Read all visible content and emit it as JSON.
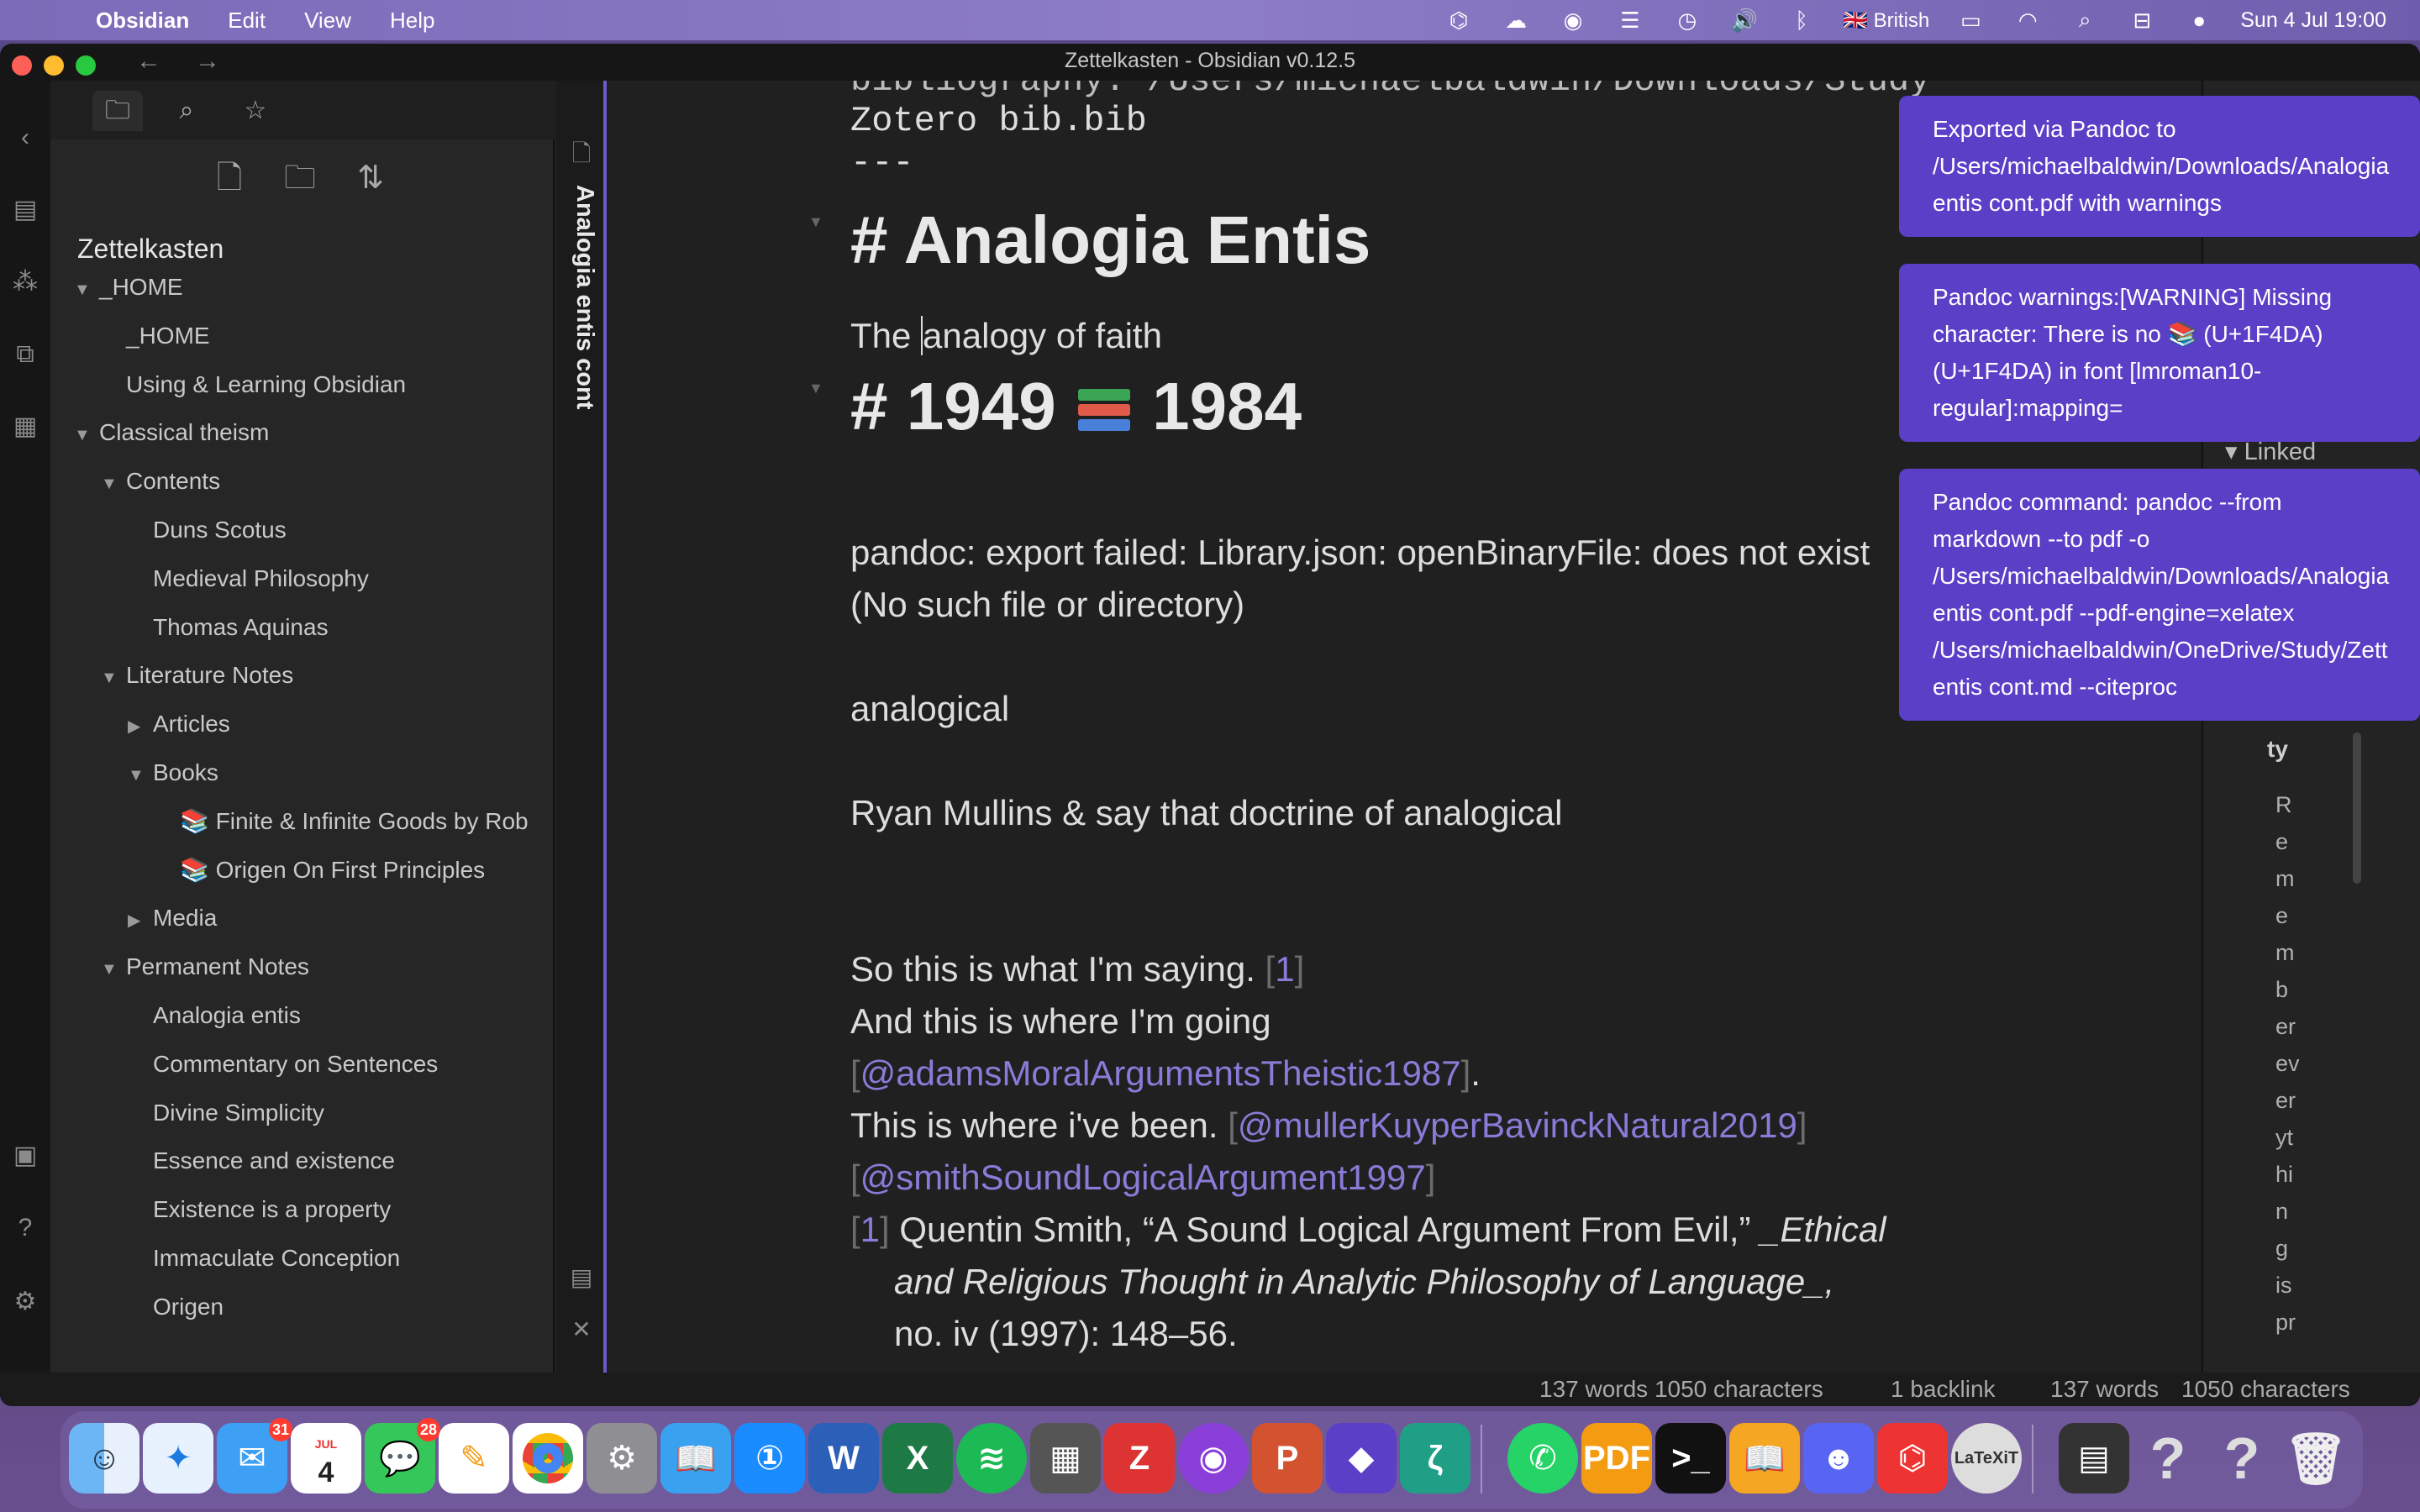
{
  "menubar": {
    "app": "Obsidian",
    "items": [
      "Edit",
      "View",
      "Help"
    ],
    "input_source": "British",
    "clock": "Sun 4 Jul  19:00"
  },
  "window": {
    "title": "Zettelkasten - Obsidian v0.12.5"
  },
  "explorer": {
    "vault": "Zettelkasten",
    "tree": [
      {
        "label": "_HOME",
        "depth": 0,
        "arrow": "▼"
      },
      {
        "label": "_HOME",
        "depth": 1,
        "arrow": ""
      },
      {
        "label": "Using & Learning Obsidian",
        "depth": 1,
        "arrow": ""
      },
      {
        "label": "Classical theism",
        "depth": 0,
        "arrow": "▼"
      },
      {
        "label": "Contents",
        "depth": 1,
        "arrow": "▼"
      },
      {
        "label": "Duns Scotus",
        "depth": 2,
        "arrow": ""
      },
      {
        "label": "Medieval Philosophy",
        "depth": 2,
        "arrow": ""
      },
      {
        "label": "Thomas Aquinas",
        "depth": 2,
        "arrow": ""
      },
      {
        "label": "Literature Notes",
        "depth": 1,
        "arrow": "▼"
      },
      {
        "label": "Articles",
        "depth": 2,
        "arrow": "▶"
      },
      {
        "label": "Books",
        "depth": 2,
        "arrow": "▼"
      },
      {
        "label": "📚 Finite & Infinite Goods by Rob",
        "depth": 3,
        "arrow": ""
      },
      {
        "label": "📚 Origen On First Principles",
        "depth": 3,
        "arrow": ""
      },
      {
        "label": "Media",
        "depth": 2,
        "arrow": "▶"
      },
      {
        "label": "Permanent Notes",
        "depth": 1,
        "arrow": "▼"
      },
      {
        "label": "Analogia entis",
        "depth": 2,
        "arrow": ""
      },
      {
        "label": "Commentary on Sentences",
        "depth": 2,
        "arrow": ""
      },
      {
        "label": "Divine Simplicity",
        "depth": 2,
        "arrow": ""
      },
      {
        "label": "Essence and existence",
        "depth": 2,
        "arrow": ""
      },
      {
        "label": "Existence is a property",
        "depth": 2,
        "arrow": ""
      },
      {
        "label": "Immaculate Conception",
        "depth": 2,
        "arrow": ""
      },
      {
        "label": "Origen",
        "depth": 2,
        "arrow": ""
      }
    ]
  },
  "tab": {
    "title": "Analogia entis cont"
  },
  "editor": {
    "top_line": "bibliography: /Users/michaelbaldwin/Downloads/Study",
    "zotero_line": "Zotero bib.bib",
    "frontmatter_end": "---",
    "h1_a": "# Analogia Entis",
    "line_analogy_before": "The ",
    "line_analogy_after": "analogy of faith",
    "h1_b_left": "# 1949",
    "h1_b_right": "1984",
    "error_1": "pandoc: export failed: Library.json: openBinaryFile: does not exist",
    "error_2": "(No such file or directory)",
    "word": "analogical",
    "ryan": "Ryan Mullins & say that doctrine of analogical",
    "saying": "So this is what I'm saying.",
    "fn_ref": "1",
    "going": "And this is where I'm going",
    "cite_adams": "@adamsMoralArgumentsTheistic1987",
    "period": ".",
    "been": "This is where i've been.",
    "cite_muller": "@mullerKuyperBavinckNatural2019",
    "cite_smith": "@smithSoundLogicalArgument1997",
    "fn_num": "1",
    "fn_text_1": "Quentin Smith, “A Sound Logical Argument From Evil,” ",
    "fn_text_1_it": "_Ethical",
    "fn_text_2": "and Religious Thought in Analytic Philosophy of Language_,",
    "fn_text_3": "no. iv (1997): 148–56."
  },
  "notices": [
    {
      "text": "Exported via Pandoc to\n/Users/michaelbaldwin/Downloads/Analogia\nentis cont.pdf with warnings"
    },
    {
      "text": "Pandoc warnings:[WARNING] Missing\ncharacter: There is no 📚 (U+1F4DA)\n(U+1F4DA) in font [lmroman10-\nregular]:mapping="
    },
    {
      "text": "Pandoc command: pandoc --from\nmarkdown --to pdf -o\n/Users/michaelbaldwin/Downloads/Analogia\nentis cont.pdf --pdf-engine=xelatex\n/Users/michaelbaldwin/OneDrive/Study/Zett\nentis cont.md --citeproc"
    }
  ],
  "rpanel": {
    "linked": "Linked",
    "ty": "ty",
    "vertical_chars": [
      "R",
      "e",
      "m",
      "e",
      "m",
      "b",
      "er",
      "ev",
      "er",
      "yt",
      "hi",
      "n",
      "g",
      "is",
      "pr"
    ]
  },
  "statusbar": {
    "words_chars_1": "137 words 1050 characters",
    "backlinks": "1 backlink",
    "words": "137 words",
    "chars": "1050 characters"
  },
  "dock": {
    "mail_badge": "31",
    "calendar_month": "JUL",
    "calendar_day": "4",
    "messages_badge": "28",
    "items": [
      "Finder",
      "Safari",
      "Mail",
      "Calendar",
      "Messages",
      "Pages",
      "Chrome",
      "Settings",
      "Kindle",
      "1Password",
      "Word",
      "Excel",
      "Spotify",
      "Calculator",
      "Zotero",
      "Podcasts",
      "PowerPoint",
      "Obsidian",
      "Zettlr",
      "WhatsApp",
      "PDF",
      "Terminal",
      "Books",
      "Discord",
      "Toolbox",
      "LaTeXiT",
      "Window",
      "Help",
      "Help",
      "Trash"
    ]
  }
}
